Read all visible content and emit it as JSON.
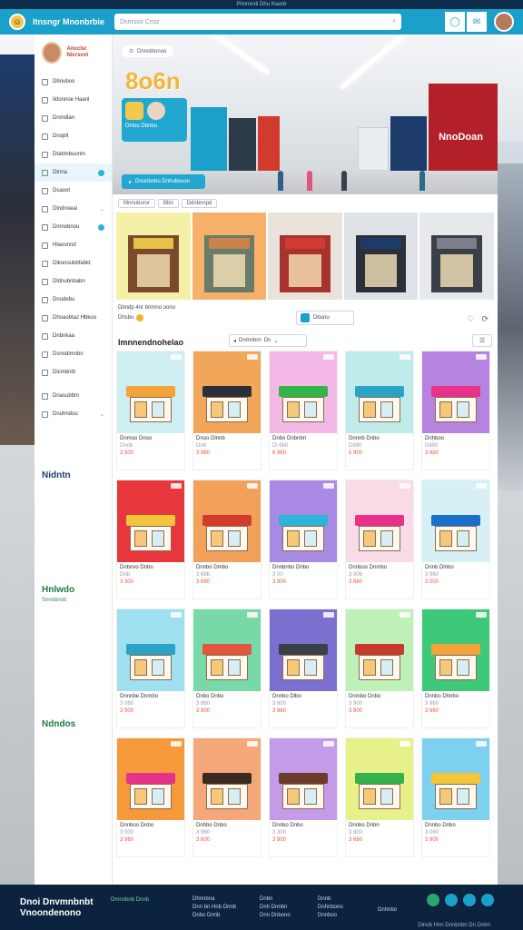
{
  "app": {
    "top_strip": "Phnmroti  Dhu  Ihaodr",
    "title": "Itnsngr Mnonbrbie",
    "search_placeholder": "Dsnrsso Cnsz",
    "colors": {
      "accent": "#1aa0c9",
      "footer": "#0c2340",
      "price": "#e2563d",
      "hero_title": "#f5b638"
    }
  },
  "header": {
    "icons": [
      "bubble-icon",
      "chat-icon",
      "user-avatar"
    ]
  },
  "sidebar": {
    "profile_name": "Ancclsr Nicrsvxt",
    "items": [
      {
        "label": "Dbnuboo",
        "icon": "grid-icon"
      },
      {
        "label": "Ildonnoe Haanl",
        "icon": "store-icon"
      },
      {
        "label": "Dnmdlan",
        "icon": "layers-icon"
      },
      {
        "label": "Dnoplt",
        "icon": "tag-icon"
      },
      {
        "label": "Dtabmbuontn",
        "icon": "chart-icon"
      },
      {
        "label": "Dtrina",
        "icon": "shop-icon",
        "active": true,
        "badge": true
      },
      {
        "label": "Dsaoot",
        "icon": "cart-icon"
      },
      {
        "label": "Dlndnoeai",
        "icon": "list-icon",
        "chevron": true
      },
      {
        "label": "Dmnobnou",
        "icon": "mail-icon",
        "badge": true
      },
      {
        "label": "Hlaoonnd",
        "icon": "bell-icon"
      },
      {
        "label": "Dlkonoubbfabkt",
        "icon": "box-icon"
      },
      {
        "label": "Dldnubnbabn",
        "icon": "user-icon"
      },
      {
        "label": "Dnudebu",
        "icon": "doc-icon"
      },
      {
        "label": "Dhoaobtaz Hbkuo",
        "icon": "heart-icon"
      },
      {
        "label": "Dnbnkaa",
        "icon": "star-icon"
      },
      {
        "label": "Dsnndimnbn",
        "icon": "gear-icon"
      },
      {
        "label": "Dicmbnitt",
        "icon": "help-icon"
      }
    ],
    "footer_items": [
      {
        "label": "Dnasubbm",
        "icon": "info-icon"
      },
      {
        "label": "Dnuhndou",
        "icon": "logout-icon",
        "chevron": true
      }
    ],
    "section_1": "Nidntn",
    "section_2": "Hnlwdo",
    "section_2_sub": "Snnnbnob",
    "section_3": "Ndndos"
  },
  "hero": {
    "tag": "Dnnsbtonoo",
    "title": "8o6n",
    "card_text": "Dlnbu Dbnbu",
    "cta": "Dnunbnbu Dnhubsuon",
    "brand": "NnoDoan"
  },
  "featured": {
    "chips": [
      "Mnnuburor",
      "Bbn",
      "Ddnbnnpd"
    ],
    "note": "Dbndp 4nr bnmno uono",
    "note2": "Dhsbu",
    "button": "Dbunu",
    "tiles": [
      {
        "bg": "#f4f0a8",
        "store": "#7a4a2a",
        "sign": "#e8c14a"
      },
      {
        "bg": "#f5b06a",
        "store": "#6a7b6a",
        "sign": "#c9824a"
      },
      {
        "bg": "#e9e3db",
        "store": "#a8322e",
        "sign": "#d03a32"
      },
      {
        "bg": "#dfe3e7",
        "store": "#2b2f3a",
        "sign": "#1d3b6a"
      },
      {
        "bg": "#e6e9ec",
        "store": "#3a3f4a",
        "sign": "#7a7f8a"
      }
    ]
  },
  "catalog": {
    "title": "Imnnendnohelao",
    "sort_label": "Dnmnbrn",
    "sort_value": "Dn",
    "filter_icon": "filter-icon",
    "products": [
      {
        "name": "Dnmoo Dnoo",
        "meta": "Dnnb",
        "price": "3 500",
        "bg": "#cfeef2",
        "roof": "#f2a33a"
      },
      {
        "name": "Dnoo Dlnnb",
        "meta": "Dnb",
        "price": "3 960",
        "bg": "#f2a65a",
        "roof": "#2a2f3a"
      },
      {
        "name": "Dnbo Dnbnbn",
        "meta": "Dl 6b0",
        "price": "6 960",
        "bg": "#f3b8e6",
        "roof": "#34b34a"
      },
      {
        "name": "Dnnnb Dnbo",
        "meta": "D990",
        "price": "5 900",
        "bg": "#bfeceb",
        "roof": "#2aa3c9"
      },
      {
        "name": "Dnhboo",
        "meta": "D690",
        "price": "3 6b0",
        "bg": "#b684e0",
        "roof": "#e8328a"
      },
      {
        "name": "Dnbnvo Dnbo",
        "meta": "Dnb",
        "price": "3 300",
        "bg": "#e8373c",
        "roof": "#f2c53a"
      },
      {
        "name": "Dnnbo Dmbo",
        "meta": "3 69b",
        "price": "3 690",
        "bg": "#f2a15a",
        "roof": "#d23a2e"
      },
      {
        "name": "Dnnbnbo Dnbo",
        "meta": "3 00",
        "price": "3 900",
        "bg": "#a889e3",
        "roof": "#2bb3d9"
      },
      {
        "name": "Dnnboo Dnmbo",
        "meta": "3 906",
        "price": "3 660",
        "bg": "#f8dbe6",
        "roof": "#e8328a"
      },
      {
        "name": "Dnnb Dlnbo",
        "meta": "3 960",
        "price": "3 000",
        "bg": "#d7f0f5",
        "roof": "#1a6fc9"
      },
      {
        "name": "Dnnnbe Dnmbo",
        "meta": "3 060",
        "price": "3 900",
        "bg": "#9fe0f0",
        "roof": "#2aa3c9"
      },
      {
        "name": "Dnbo Dnbo",
        "meta": "3 960",
        "price": "3 900",
        "bg": "#78d8a8",
        "roof": "#e2563d"
      },
      {
        "name": "Dnnbo Dlbo",
        "meta": "3 600",
        "price": "3 960",
        "bg": "#7b6fd0",
        "roof": "#3a3f4a"
      },
      {
        "name": "Dnmbo Dnbo",
        "meta": "3 900",
        "price": "3 900",
        "bg": "#bff0b8",
        "roof": "#c93a2e"
      },
      {
        "name": "Dnnbo Dhnbo",
        "meta": "3 960",
        "price": "3 660",
        "bg": "#3ec97a",
        "roof": "#f2a33a"
      },
      {
        "name": "Dnnboo Dnbo",
        "meta": "3 000",
        "price": "3 960",
        "bg": "#f49a3a",
        "roof": "#e8328a"
      },
      {
        "name": "Dnhbo Dnbo",
        "meta": "3 960",
        "price": "3 600",
        "bg": "#f4a87a",
        "roof": "#3a2a22"
      },
      {
        "name": "Dnnbo Dnbo",
        "meta": "3 300",
        "price": "3 900",
        "bg": "#c49be8",
        "roof": "#6a3a2a"
      },
      {
        "name": "Dnnbo Dnbn",
        "meta": "3 900",
        "price": "3 660",
        "bg": "#e8f08a",
        "roof": "#34b34a"
      },
      {
        "name": "Dnnbo Dnbo",
        "meta": "3 060",
        "price": "3 900",
        "bg": "#7ed0f0",
        "roof": "#f2c53a"
      }
    ]
  },
  "footer": {
    "brand": "Dnoi Dnvmnbnbt",
    "brand_sub": "Vnoondenono",
    "green_text": "Dmnnbnb Dnnb",
    "col1": [
      "Dhnnbna",
      "Dnn bn Hnb Dnnb",
      "Dnbo Dnnb"
    ],
    "col2": [
      "Dnbn",
      "Dnh Dnnbn",
      "Dnn Dnbono"
    ],
    "col3": [
      "Dnnb",
      "Dnhnbono",
      "Dnnboo"
    ],
    "col4": [
      "Dnhnbo"
    ],
    "copyright": "Dlnob Hnn Dnnbnbn   Dn   Dnbn"
  }
}
